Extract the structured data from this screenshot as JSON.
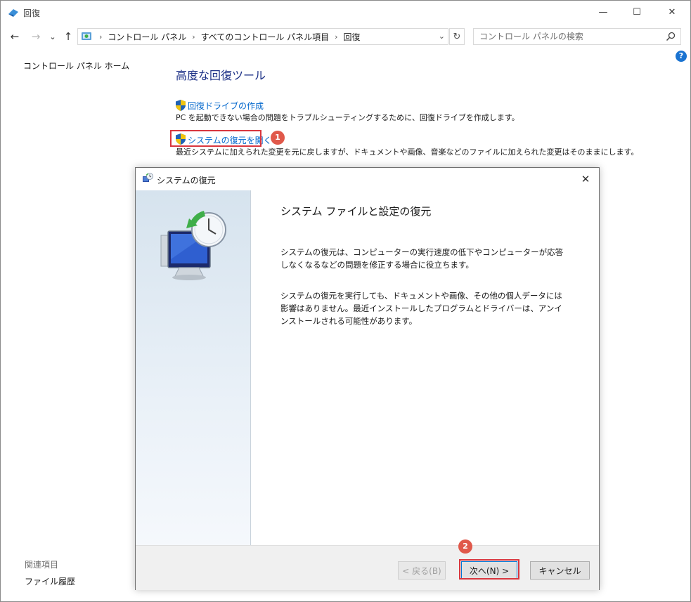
{
  "window": {
    "title": "回復",
    "minimize": "—",
    "maximize": "☐",
    "close": "✕"
  },
  "nav": {
    "back": "←",
    "forward": "→",
    "recent": "⌄",
    "up": "↑",
    "breadcrumbs": [
      "コントロール パネル",
      "すべてのコントロール パネル項目",
      "回復"
    ],
    "separator": "›",
    "dropdown": "⌄",
    "refresh": "↻",
    "search_placeholder": "コントロール パネルの検索"
  },
  "help": "?",
  "sidebar": {
    "home": "コントロール パネル ホーム",
    "related_heading": "関連項目",
    "related_link": "ファイル履歴"
  },
  "main": {
    "heading": "高度な回復ツール",
    "tools": [
      {
        "label": "回復ドライブの作成",
        "desc": "PC を起動できない場合の問題をトラブルシューティングするために、回復ドライブを作成します。"
      },
      {
        "label": "システムの復元を開く",
        "desc": "最近システムに加えられた変更を元に戻しますが、ドキュメントや画像、音楽などのファイルに加えられた変更はそのままにします。"
      }
    ]
  },
  "badges": {
    "step1": "1",
    "step2": "2"
  },
  "dialog": {
    "title": "システムの復元",
    "close": "✕",
    "heading": "システム ファイルと設定の復元",
    "para1": "システムの復元は、コンピューターの実行速度の低下やコンピューターが応答しなくなるなどの問題を修正する場合に役立ちます。",
    "para2": "システムの復元を実行しても、ドキュメントや画像、その他の個人データには影響はありません。最近インストールしたプログラムとドライバーは、アンインストールされる可能性があります。",
    "back_button": "< 戻る(B)",
    "next_button": "次へ(N) >",
    "cancel_button": "キャンセル"
  },
  "colors": {
    "link": "#0066cc",
    "heading": "#1e3287",
    "highlight": "#d9363e",
    "badge": "#e0584a"
  }
}
